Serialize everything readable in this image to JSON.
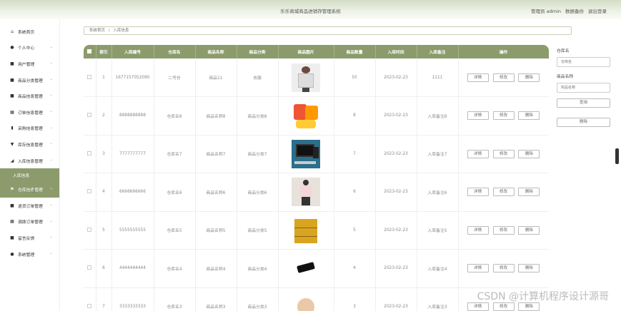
{
  "header": {
    "title": "乐乐商城商品进销存管理系统",
    "admin_label": "管理员 admin",
    "backup_label": "数据备份",
    "logout_label": "退出登录"
  },
  "sidebar": {
    "items": [
      {
        "label": "系统首页",
        "icon": "home-icon",
        "glyph": "⌂"
      },
      {
        "label": "个人中心",
        "icon": "user-icon",
        "glyph": "●"
      },
      {
        "label": "用户管理",
        "icon": "users-icon",
        "glyph": "■"
      },
      {
        "label": "商品分类管理",
        "icon": "category-icon",
        "glyph": "■"
      },
      {
        "label": "商品信息管理",
        "icon": "product-icon",
        "glyph": "■"
      },
      {
        "label": "订单信息管理",
        "icon": "order-icon",
        "glyph": "▦"
      },
      {
        "label": "采购信息管理",
        "icon": "purchase-icon",
        "glyph": "▮"
      },
      {
        "label": "库存信息管理",
        "icon": "stock-icon",
        "glyph": "▼"
      },
      {
        "label": "入库信息管理",
        "icon": "inbound-icon",
        "glyph": "◢"
      },
      {
        "label": "仓库信息管理",
        "icon": "warehouse-icon",
        "glyph": "⚑"
      },
      {
        "label": "退货订单管理",
        "icon": "return-icon",
        "glyph": "■"
      },
      {
        "label": "调拨订单管理",
        "icon": "transfer-icon",
        "glyph": "▦"
      },
      {
        "label": "留言反馈",
        "icon": "message-icon",
        "glyph": "■"
      },
      {
        "label": "系统管理",
        "icon": "settings-icon",
        "glyph": "●"
      }
    ],
    "sub_active": "入库信息"
  },
  "breadcrumb": {
    "home": "系统首页",
    "sep": "/",
    "current": "入库信息"
  },
  "table": {
    "headers": [
      "",
      "索引",
      "入库编号",
      "仓库名",
      "商品名称",
      "商品分类",
      "商品图片",
      "商品数量",
      "入库时间",
      "入库备注",
      "操作"
    ],
    "rows": [
      {
        "index": "1",
        "no": "1677157052090",
        "warehouse": "二号仓",
        "name": "商品11",
        "category": "衣服",
        "qty": "50",
        "time": "2023-02-23",
        "note": "1111",
        "img": "shirt"
      },
      {
        "index": "2",
        "no": "8888888888",
        "warehouse": "仓库名8",
        "name": "商品名称8",
        "category": "商品分类8",
        "qty": "8",
        "time": "2023-02-23",
        "note": "入库备注8",
        "img": "snack"
      },
      {
        "index": "3",
        "no": "7777777777",
        "warehouse": "仓库名7",
        "name": "商品名称7",
        "category": "商品分类7",
        "qty": "7",
        "time": "2023-02-23",
        "note": "入库备注7",
        "img": "monitor"
      },
      {
        "index": "4",
        "no": "6666666666",
        "warehouse": "仓库名6",
        "name": "商品名称6",
        "category": "商品分类6",
        "qty": "6",
        "time": "2023-02-23",
        "note": "入库备注6",
        "img": "dress"
      },
      {
        "index": "5",
        "no": "5555555555",
        "warehouse": "仓库名5",
        "name": "商品名称5",
        "category": "商品分类5",
        "qty": "5",
        "time": "2023-02-23",
        "note": "入库备注5",
        "img": "shelf"
      },
      {
        "index": "6",
        "no": "4444444444",
        "warehouse": "仓库名4",
        "name": "商品名称4",
        "category": "商品分类4",
        "qty": "4",
        "time": "2023-02-23",
        "note": "入库备注4",
        "img": "camera"
      },
      {
        "index": "7",
        "no": "3333333333",
        "warehouse": "仓库名3",
        "name": "商品名称3",
        "category": "商品分类3",
        "qty": "3",
        "time": "2023-02-23",
        "note": "入库备注3",
        "img": "beige"
      }
    ],
    "actions": {
      "detail": "详情",
      "edit": "修改",
      "delete": "删除"
    }
  },
  "search": {
    "warehouse_label": "仓库名",
    "warehouse_placeholder": "仓库名",
    "product_label": "商品名称",
    "product_placeholder": "商品名称",
    "query_button": "查询",
    "delete_button": "删除"
  },
  "watermark": "CSDN @计算机程序设计源哥",
  "colors": {
    "accent": "#8c9b6c",
    "header_bg": "#d4dcc6"
  }
}
